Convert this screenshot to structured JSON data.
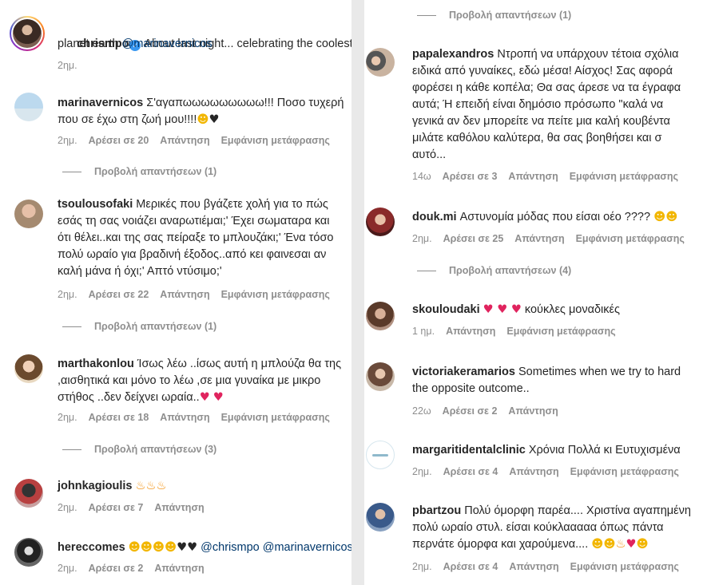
{
  "left": {
    "post": {
      "username": "chrismpo",
      "caption": "About last night... celebrating the coolest",
      "caption2": "planet earth",
      "mention": "@marinavernicos",
      "time": "2ημ."
    },
    "comments": [
      {
        "username": "marinavernicos",
        "lines": [
          "Σ'αγαπωωωωωωωωω!!! Ποσο τυχερή",
          "που σε έχω στη ζωή μου!!!!"
        ],
        "time": "2ημ.",
        "likes": "Αρέσει σε 20",
        "reply": "Απάντηση",
        "translate": "Εμφάνιση μετάφρασης",
        "view_replies": "Προβολή απαντήσεων (1)"
      },
      {
        "username": "tsoulousofaki",
        "lines": [
          "Μερικές που βγάζετε χολή για το πώς",
          "εσάς τη σας νοιάζει αναρωτιέμαι;' Έχει σωματαρα και",
          "ότι θέλει..και της σας πείραξε το μπλουζάκι;' Ένα τόσο",
          "πολύ ωραίο για βραδινή έξοδος..από κει φαινεσαι αν",
          "καλή μάνα ή όχι;' Απτό ντύσιμο;'"
        ],
        "time": "2ημ.",
        "likes": "Αρέσει σε 22",
        "reply": "Απάντηση",
        "translate": "Εμφάνιση μετάφρασης",
        "view_replies": "Προβολή απαντήσεων (1)"
      },
      {
        "username": "marthakonlou",
        "lines": [
          "Ίσως λέω ..ίσως αυτή η μπλούζα θα της",
          ",αισθητικά και μόνο το λέω ,σε μια γυναίκα με μικρο",
          "στήθος ..δεν δείχνει ωραία.."
        ],
        "time": "2ημ.",
        "likes": "Αρέσει σε 18",
        "reply": "Απάντηση",
        "translate": "Εμφάνιση μετάφρασης",
        "view_replies": "Προβολή απαντήσεων (3)"
      },
      {
        "username": "johnkagioulis",
        "time": "2ημ.",
        "likes": "Αρέσει σε 7",
        "reply": "Απάντηση"
      },
      {
        "username": "hereccomes",
        "mentions": "@chrismpo @marinavernicos",
        "time": "2ημ.",
        "likes": "Αρέσει σε 2",
        "reply": "Απάντηση"
      }
    ]
  },
  "right": {
    "top_replies": "Προβολή απαντήσεων (1)",
    "comments": [
      {
        "username": "papalexandros",
        "lines": [
          "Ντροπή να υπάρχουν τέτοια σχόλια",
          "ειδικά από γυναίκες, εδώ μέσα! Αίσχος! Σας αφορά",
          "φορέσει η κάθε κοπέλα; Θα σας άρεσε να τα έγραφα",
          "αυτά; Ή επειδή είναι δημόσιο πρόσωπο \"καλά να",
          "γενικά αν δεν μπορείτε να πείτε μια καλή κουβέντα",
          "μιλάτε καθόλου καλύτερα, θα σας βοηθήσει και σ",
          "αυτό..."
        ],
        "time": "14ω",
        "likes": "Αρέσει σε 3",
        "reply": "Απάντηση",
        "translate": "Εμφάνιση μετάφρασης"
      },
      {
        "username": "douk.mi",
        "text": "Αστυνομία μόδας που είσαι οέο ????",
        "time": "2ημ.",
        "likes": "Αρέσει σε 25",
        "reply": "Απάντηση",
        "translate": "Εμφάνιση μετάφρασης",
        "view_replies": "Προβολή απαντήσεων (4)"
      },
      {
        "username": "skouloudaki",
        "text": "κούκλες μοναδικές",
        "time": "1 ημ.",
        "reply": "Απάντηση",
        "translate": "Εμφάνιση μετάφρασης"
      },
      {
        "username": "victoriakeramarios",
        "lines": [
          "Sometimes when we try to hard",
          "the opposite outcome.."
        ],
        "time": "22ω",
        "likes": "Αρέσει σε 2",
        "reply": "Απάντηση"
      },
      {
        "username": "margaritidentalclinic",
        "text": "Χρόνια Πολλά κι Ευτυχισμένα",
        "time": "2ημ.",
        "likes": "Αρέσει σε 4",
        "reply": "Απάντηση",
        "translate": "Εμφάνιση μετάφρασης"
      },
      {
        "username": "pbartzou",
        "lines": [
          "Πολύ όμορφη παρέα.... Χριστίνα αγαπημένη",
          "πολύ ωραίο στυλ. είσαι κούκλααααα όπως πάντα",
          "περνάτε όμορφα και χαρούμενα...."
        ],
        "time": "2ημ.",
        "likes": "Αρέσει σε 4",
        "reply": "Απάντηση",
        "translate": "Εμφάνιση μετάφρασης"
      }
    ]
  },
  "colors": {
    "text": "#262626",
    "meta": "#8e8e8e",
    "mention": "#00376b",
    "verified": "#3897f0",
    "heart": "#e0245e"
  }
}
